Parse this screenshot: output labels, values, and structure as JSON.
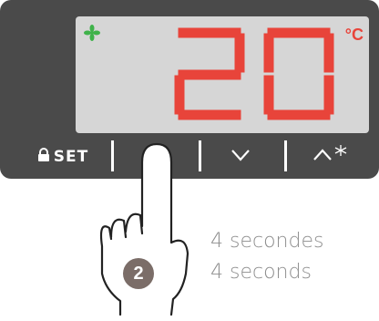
{
  "display": {
    "temperature": "20",
    "unit": "°C",
    "fan_icon": "fan-icon",
    "accent_color": "#e8443a",
    "fan_color": "#3fb24a"
  },
  "buttons": {
    "set_label": "SET",
    "lock_icon": "lock-icon",
    "power_icon": "power-icon",
    "down_icon": "chevron-down-icon",
    "up_icon": "chevron-up-icon",
    "defrost_icon": "defrost-icon"
  },
  "instruction": {
    "step_number": "2",
    "line1": "4 secondes",
    "line2": "4 seconds",
    "hand_icon": "pointing-hand-icon"
  }
}
